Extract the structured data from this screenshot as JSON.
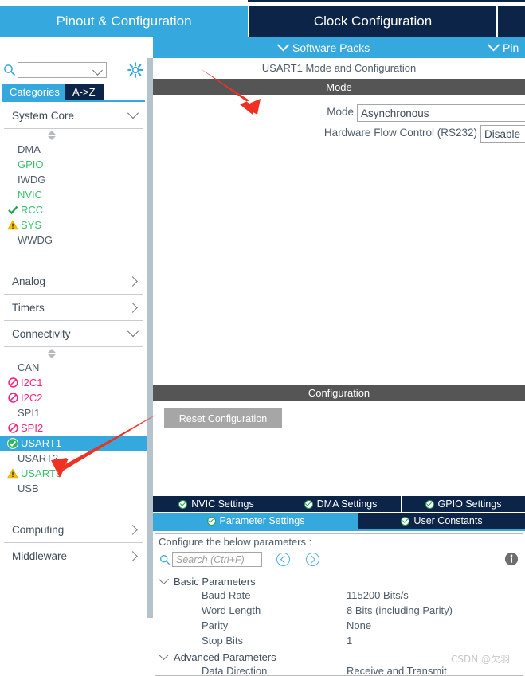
{
  "main_tabs": [
    {
      "label": "Pinout & Configuration",
      "active": true
    },
    {
      "label": "Clock Configuration",
      "active": false
    },
    {
      "label": "",
      "active": false
    }
  ],
  "sub_bar": {
    "software_packs": "Software Packs",
    "pinout_partial": "Pin"
  },
  "left_panel": {
    "search_placeholder": "",
    "search_value": "",
    "icons": {
      "search": "search-icon",
      "settings": "gear-icon"
    },
    "view_tabs": [
      {
        "label": "Categories",
        "active": true
      },
      {
        "label": "A->Z",
        "active": false
      }
    ],
    "groups": [
      {
        "name": "System Core",
        "expanded": true,
        "items": [
          {
            "label": "DMA",
            "status": "none",
            "color": "grey"
          },
          {
            "label": "GPIO",
            "status": "none",
            "color": "green"
          },
          {
            "label": "IWDG",
            "status": "none",
            "color": "grey"
          },
          {
            "label": "NVIC",
            "status": "none",
            "color": "green"
          },
          {
            "label": "RCC",
            "status": "check",
            "color": "green"
          },
          {
            "label": "SYS",
            "status": "warning",
            "color": "green"
          },
          {
            "label": "WWDG",
            "status": "none",
            "color": "grey"
          }
        ]
      },
      {
        "name": "Analog",
        "expanded": false,
        "items": []
      },
      {
        "name": "Timers",
        "expanded": false,
        "items": []
      },
      {
        "name": "Connectivity",
        "expanded": true,
        "items": [
          {
            "label": "CAN",
            "status": "none",
            "color": "grey"
          },
          {
            "label": "I2C1",
            "status": "blocked",
            "color": "pink"
          },
          {
            "label": "I2C2",
            "status": "blocked",
            "color": "pink"
          },
          {
            "label": "SPI1",
            "status": "none",
            "color": "grey"
          },
          {
            "label": "SPI2",
            "status": "blocked",
            "color": "pink"
          },
          {
            "label": "USART1",
            "status": "ok",
            "color": "grey",
            "selected": true
          },
          {
            "label": "USART2",
            "status": "none",
            "color": "grey"
          },
          {
            "label": "USART3",
            "status": "warning",
            "color": "green"
          },
          {
            "label": "USB",
            "status": "none",
            "color": "grey"
          }
        ]
      },
      {
        "name": "Computing",
        "expanded": false,
        "items": []
      },
      {
        "name": "Middleware",
        "expanded": false,
        "items": []
      }
    ]
  },
  "right_panel": {
    "caption": "USART1 Mode and Configuration",
    "mode_section": {
      "band_title": "Mode",
      "fields": [
        {
          "label": "Mode",
          "value": "Asynchronous"
        },
        {
          "label": "Hardware Flow Control (RS232)",
          "value": "Disable"
        }
      ]
    },
    "config_section": {
      "band_title": "Configuration",
      "reset_button": "Reset Configuration",
      "tabs_row1": [
        {
          "label": "NVIC Settings",
          "selected": false
        },
        {
          "label": "DMA Settings",
          "selected": false
        },
        {
          "label": "GPIO Settings",
          "selected": false
        }
      ],
      "tabs_row2": [
        {
          "label": "Parameter Settings",
          "selected": true
        },
        {
          "label": "User Constants",
          "selected": false
        }
      ],
      "note": "Configure the below parameters :",
      "search_placeholder": "Search (Ctrl+F)",
      "search_value": "",
      "parameter_groups": [
        {
          "name": "Basic Parameters",
          "expanded": true,
          "rows": [
            {
              "name": "Baud Rate",
              "value": "115200 Bits/s"
            },
            {
              "name": "Word Length",
              "value": "8 Bits (including Parity)"
            },
            {
              "name": "Parity",
              "value": "None"
            },
            {
              "name": "Stop Bits",
              "value": "1"
            }
          ]
        },
        {
          "name": "Advanced Parameters",
          "expanded": true,
          "rows": [
            {
              "name": "Data Direction",
              "value": "Receive and Transmit"
            }
          ]
        }
      ]
    }
  },
  "watermark": "CSDN @欠羽",
  "colors": {
    "accent_blue": "#35a8de",
    "navy": "#0b2447",
    "band_grey": "#555555",
    "green": "#3bbf6d",
    "pink": "#f4277f",
    "warning_yellow": "#f6c000",
    "arrow_red": "#ef3124"
  }
}
